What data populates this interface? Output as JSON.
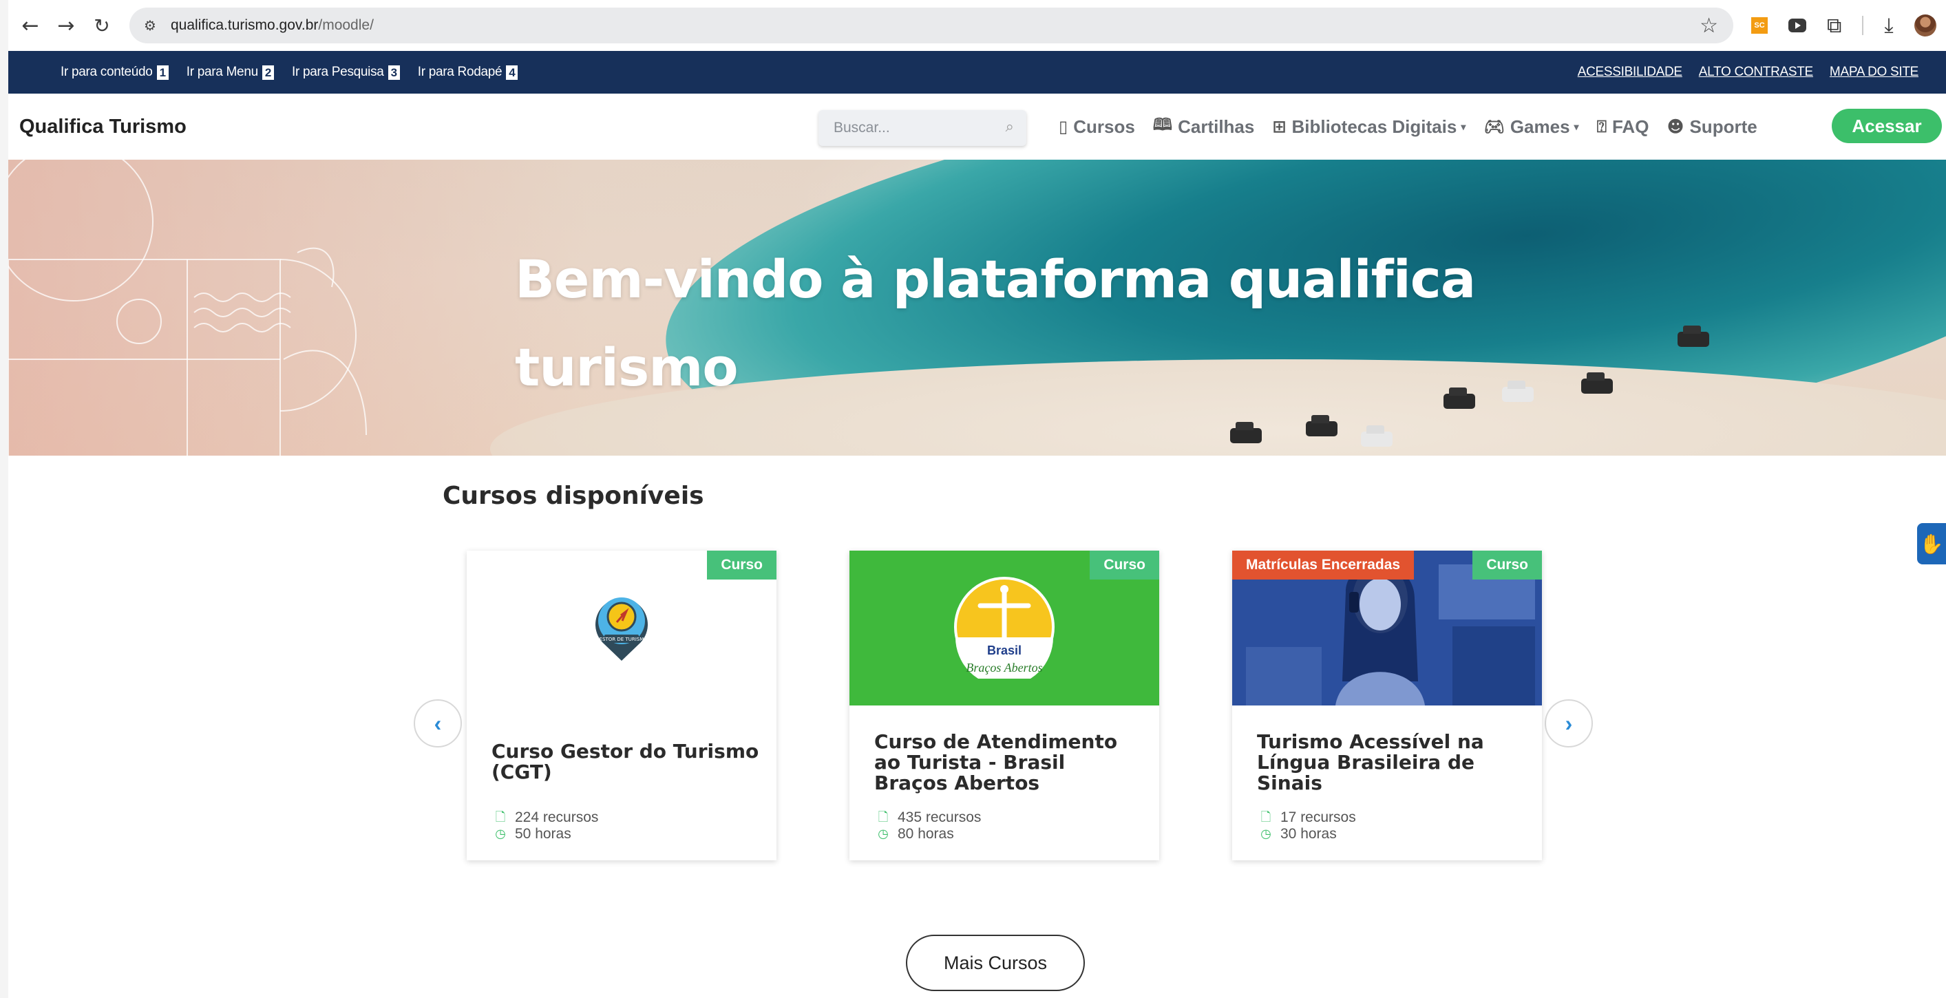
{
  "browser": {
    "url_host": "qualifica.turismo.gov.br",
    "url_path": "/moodle/",
    "extensions": [
      "sc-extension",
      "media-extension",
      "puzzle-extension",
      "download-icon",
      "profile-avatar"
    ]
  },
  "accessibility_bar": {
    "skip_links": [
      {
        "label": "Ir para conteúdo",
        "key": "1"
      },
      {
        "label": "Ir para Menu",
        "key": "2"
      },
      {
        "label": "Ir para Pesquisa",
        "key": "3"
      },
      {
        "label": "Ir para Rodapé",
        "key": "4"
      }
    ],
    "links": [
      "ACESSIBILIDADE",
      "ALTO CONTRASTE",
      "MAPA DO SITE"
    ]
  },
  "header": {
    "brand": "Qualifica Turismo",
    "search_placeholder": "Buscar...",
    "nav": [
      {
        "label": "Cursos",
        "icon": "book-icon"
      },
      {
        "label": "Cartilhas",
        "icon": "open-book-icon"
      },
      {
        "label": "Bibliotecas Digitais",
        "icon": "grid-icon",
        "dropdown": true
      },
      {
        "label": "Games",
        "icon": "gamepad-icon",
        "dropdown": true
      },
      {
        "label": "FAQ",
        "icon": "question-icon"
      },
      {
        "label": "Suporte",
        "icon": "support-icon"
      }
    ],
    "login_label": "Acessar"
  },
  "hero": {
    "title": "Bem-vindo à plataforma qualifica turismo"
  },
  "courses": {
    "title": "Cursos disponíveis",
    "prev_label": "‹",
    "next_label": "›",
    "items": [
      {
        "title": "Curso Gestor do Turismo (CGT)",
        "type_badge": "Curso",
        "resources": "224 recursos",
        "hours": "50 horas",
        "logo_text": "GESTOR DE TURISMO"
      },
      {
        "title": "Curso de Atendimento ao Turista - Brasil Braços Abertos",
        "type_badge": "Curso",
        "resources": "435 recursos",
        "hours": "80 horas",
        "logo_word": "Brasil",
        "logo_script": "Braços Abertos"
      },
      {
        "title": "Turismo Acessível na Língua Brasileira de Sinais",
        "type_badge": "Curso",
        "status_badge": "Matrículas Encerradas",
        "resources": "17 recursos",
        "hours": "30 horas"
      }
    ],
    "more_label": "Mais Cursos"
  },
  "colors": {
    "accessibility_bar": "#17305a",
    "primary_green": "#3cbf6a",
    "badge_green": "#47c17a",
    "badge_closed": "#e2532f",
    "card2_bg": "#3fb93c"
  }
}
